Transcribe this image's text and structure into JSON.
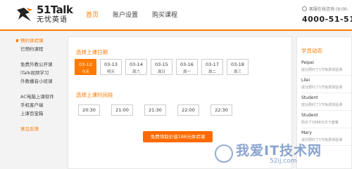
{
  "header": {
    "logo_en": "51Talk",
    "logo_cn": "无忧英语",
    "nav": [
      {
        "label": "首页",
        "active": true
      },
      {
        "label": "账户设置",
        "active": false
      },
      {
        "label": "购买课程",
        "active": false
      }
    ],
    "hotline_label": "客服在线咨询 (9:00-",
    "hotline_number": "4000-51-51-"
  },
  "sidebar": {
    "groups": [
      [
        "预约体验课",
        "已预约课程"
      ],
      [
        "免费外教公开课",
        "iTalk视频学习",
        "外教播音小班课"
      ],
      [
        "AC电脑上课软件",
        "手机客户端",
        "上课百宝箱"
      ],
      [
        "意见反馈"
      ]
    ]
  },
  "main": {
    "date_title": "选择上课日期",
    "dates": [
      {
        "date": "03-12",
        "week": "今天",
        "selected": true
      },
      {
        "date": "03-13",
        "week": "明天",
        "selected": false
      },
      {
        "date": "03-14",
        "week": "周六",
        "selected": false
      },
      {
        "date": "03-15",
        "week": "周日",
        "selected": false
      },
      {
        "date": "03-16",
        "week": "周一",
        "selected": false
      },
      {
        "date": "03-17",
        "week": "周二",
        "selected": false
      },
      {
        "date": "03-18",
        "week": "周三",
        "selected": false
      }
    ],
    "time_title": "选择上课时间段",
    "times": [
      "20:30",
      "21:00",
      "21:30",
      "22:00",
      "22:30"
    ],
    "cta": "免费领取价值188元体验课"
  },
  "right": {
    "title": "学员动态",
    "feed": [
      {
        "name": "Peipei",
        "desc": "成功预约了1节免费体验课"
      },
      {
        "name": "Lilei",
        "desc": "成功预约了1节免费体验课"
      },
      {
        "name": "Student",
        "desc": "成功预约了1节免费体验课"
      },
      {
        "name": "Student",
        "desc": "购买了5888元次卡套餐"
      },
      {
        "name": "Mary",
        "desc": "成功预约了1节免费体验课"
      }
    ]
  },
  "watermark": {
    "text": "我爱IT技术网",
    "url": "52ij.com"
  },
  "colors": {
    "accent": "#ff7a00",
    "watermark": "#285aaa"
  }
}
